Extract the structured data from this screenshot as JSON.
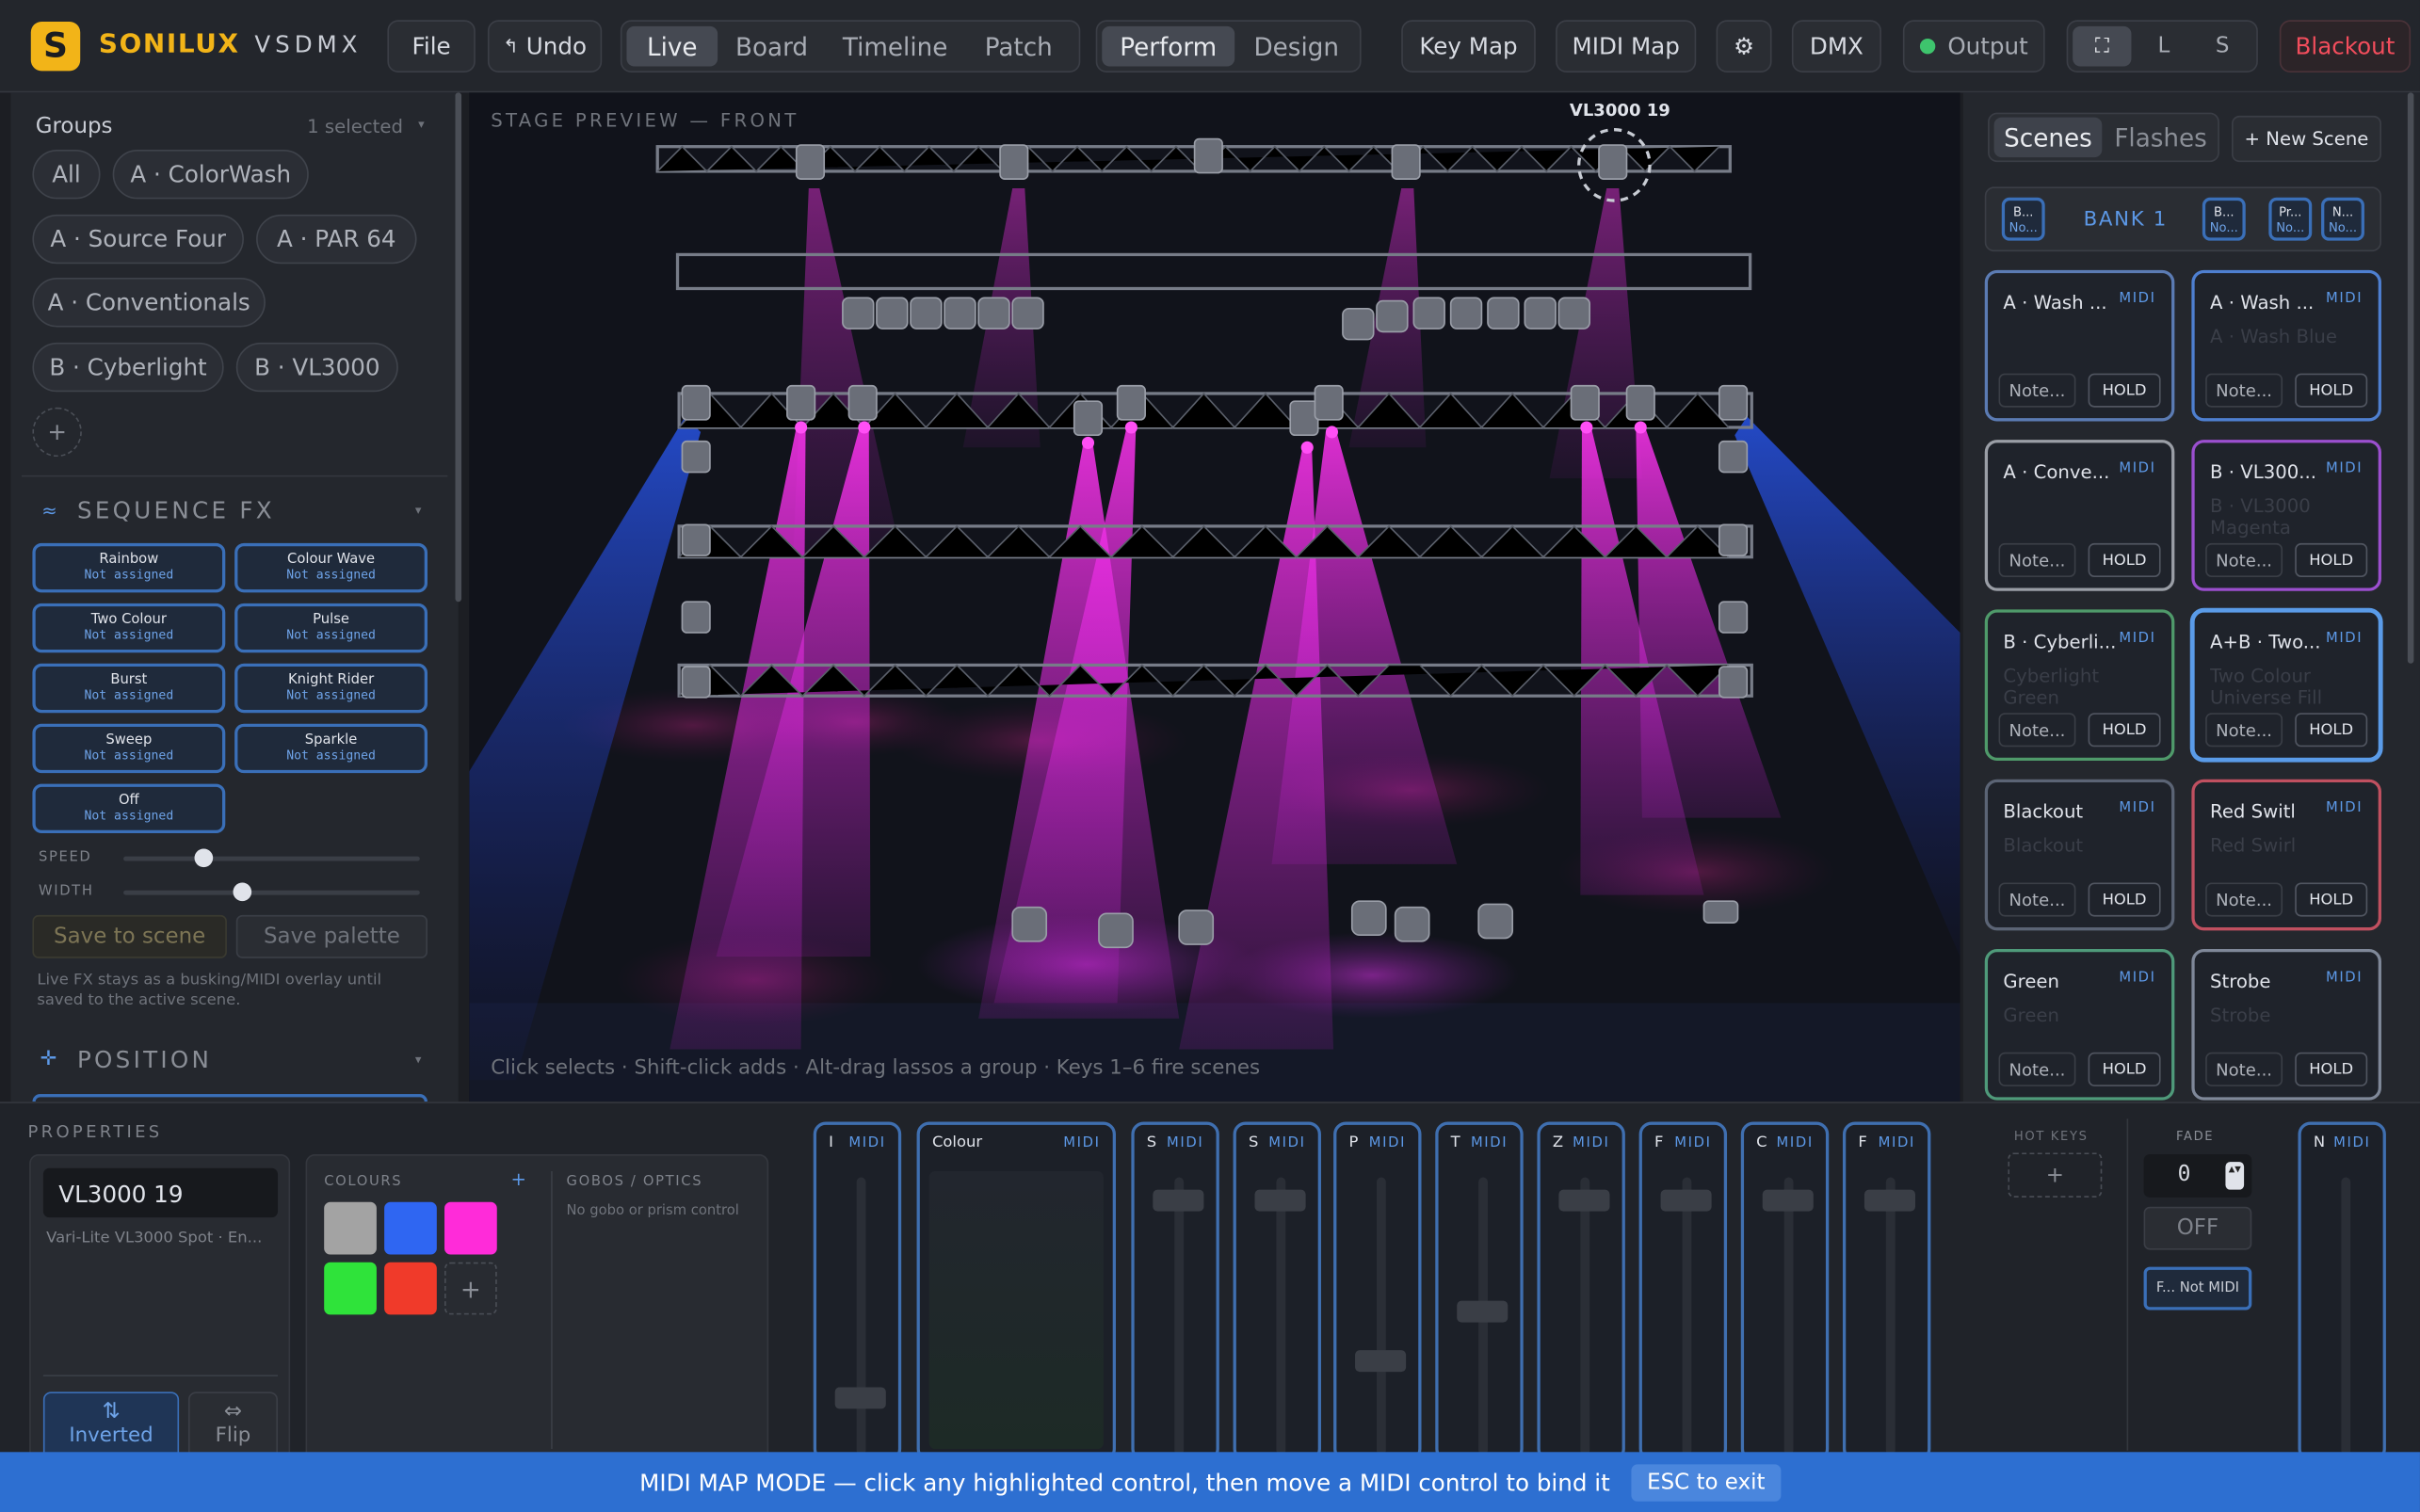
{
  "app": {
    "name": "SONILUX",
    "product": "VSDMX"
  },
  "topbar": {
    "file": "File",
    "undo": "Undo",
    "tabs": [
      "Live",
      "Board",
      "Timeline",
      "Patch"
    ],
    "modes": [
      "Perform",
      "Design"
    ],
    "key_map": "Key Map",
    "midi_map": "MIDI Map",
    "settings_icon": "⚙",
    "dmx": "DMX",
    "output": "Output",
    "sizes": [
      "⛶",
      "L",
      "S"
    ],
    "blackout": "Blackout"
  },
  "groups": {
    "title": "Groups",
    "selected": "1 selected",
    "chips": [
      "All",
      "A · ColorWash",
      "A · Source Four",
      "A · PAR 64",
      "A · Conventionals",
      "B · Cyberlight",
      "B · VL3000"
    ],
    "add": "+"
  },
  "sequence_fx": {
    "title": "SEQUENCE FX",
    "items": [
      {
        "name": "Rainbow",
        "status": "Not assigned"
      },
      {
        "name": "Colour Wave",
        "status": "Not assigned"
      },
      {
        "name": "Two Colour",
        "status": "Not assigned"
      },
      {
        "name": "Pulse",
        "status": "Not assigned"
      },
      {
        "name": "Burst",
        "status": "Not assigned"
      },
      {
        "name": "Knight Rider",
        "status": "Not assigned"
      },
      {
        "name": "Sweep",
        "status": "Not assigned"
      },
      {
        "name": "Sparkle",
        "status": "Not assigned"
      },
      {
        "name": "Off",
        "status": "Not assigned"
      }
    ],
    "speed_label": "SPEED",
    "width_label": "WIDTH",
    "speed": 0.27,
    "width": 0.4,
    "save_scene": "Save to scene",
    "save_palette": "Save palette",
    "note": "Live FX stays as a busking/MIDI overlay until saved to the active scene.",
    "position_title": "POSITION"
  },
  "stage": {
    "title": "STAGE PREVIEW — FRONT",
    "selected_label": "VL3000 19",
    "hint": "Click selects · Shift-click adds · Alt-drag lassos a group · Keys 1–6 fire scenes"
  },
  "scenes": {
    "tabs": [
      "Scenes",
      "Flashes"
    ],
    "new_scene": "+ New Scene",
    "bank": "BANK 1",
    "bank_buttons": [
      {
        "a": "B...",
        "b": "No..."
      },
      {
        "a": "B...",
        "b": "No..."
      },
      {
        "a": "Pr...",
        "b": "No..."
      },
      {
        "a": "N...",
        "b": "No..."
      }
    ],
    "cards": [
      {
        "title": "A · Wash ...",
        "ghost": "",
        "color": "#5b7bb3"
      },
      {
        "title": "A · Wash ...",
        "ghost": "A · Wash Blue",
        "color": "#4e7fd0"
      },
      {
        "title": "A · Conve...",
        "ghost": "",
        "color": "#9a9ea6"
      },
      {
        "title": "B · VL300...",
        "ghost": "B · VL3000 Magenta",
        "color": "#9b4fcf"
      },
      {
        "title": "B · Cyberli...",
        "ghost": "Cyberlight Green",
        "color": "#4f9a6a"
      },
      {
        "title": "A+B · Two...",
        "ghost": "Two Colour Universe Fill",
        "color": "#5a9be8"
      },
      {
        "title": "Blackout",
        "ghost": "Blackout",
        "color": "#5b6475"
      },
      {
        "title": "Red Switl",
        "ghost": "Red Swirl",
        "color": "#c05060"
      },
      {
        "title": "Green",
        "ghost": "Green",
        "color": "#4f9a7a"
      },
      {
        "title": "Strobe",
        "ghost": "Strobe",
        "color": "#7f8899"
      }
    ],
    "midi": "MIDI",
    "note": "Note...",
    "hold": "HOLD"
  },
  "properties": {
    "title": "PROPERTIES",
    "fixture_name": "VL3000 19",
    "fixture_desc": "Vari-Lite VL3000 Spot · En...",
    "inverted": "Inverted",
    "flip": "Flip",
    "colours_title": "COLOURS",
    "colours": [
      "#a3a3a3",
      "#2f66f2",
      "#ff2bd9",
      "#2fe33a",
      "#f03a2a"
    ],
    "gobos_title": "GOBOS / OPTICS",
    "gobos_note": "No gobo or prism control"
  },
  "faders": [
    {
      "label": "I",
      "level": 0.15
    },
    {
      "label": "Colour",
      "level": 0.0
    },
    {
      "label": "S",
      "level": 0.95
    },
    {
      "label": "S",
      "level": 0.95
    },
    {
      "label": "P",
      "level": 0.3
    },
    {
      "label": "T",
      "level": 0.5
    },
    {
      "label": "Z",
      "level": 0.95
    },
    {
      "label": "F",
      "level": 0.95
    },
    {
      "label": "C",
      "level": 0.95
    },
    {
      "label": "F",
      "level": 0.95
    }
  ],
  "hotkeys": {
    "title": "HOT KEYS",
    "add": "+"
  },
  "fade": {
    "title": "FADE",
    "value": "0",
    "off": "OFF",
    "assign": "F... Not MIDI"
  },
  "master": {
    "label": "N",
    "midi": "MIDI"
  },
  "banner": {
    "text": "MIDI MAP MODE — click any highlighted control, then move a MIDI control to bind it",
    "esc": "ESC to exit"
  }
}
